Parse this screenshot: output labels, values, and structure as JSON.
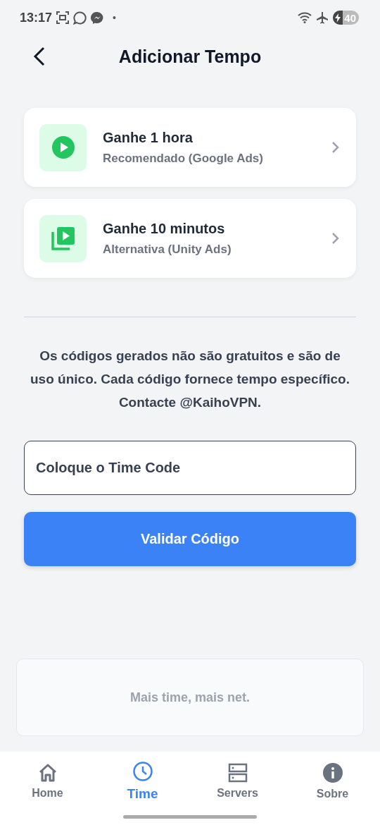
{
  "status_bar": {
    "time": "13:17",
    "dot": "•",
    "battery": "40"
  },
  "header": {
    "title": "Adicionar Tempo"
  },
  "options": [
    {
      "kind": "play",
      "title": "Ganhe 1 hora",
      "subtitle": "Recomendado (Google Ads)"
    },
    {
      "kind": "library",
      "title": "Ganhe 10 minutos",
      "subtitle": "Alternativa (Unity Ads)"
    }
  ],
  "notice": "Os códigos gerados não são gratuitos e são de uso único. Cada código fornece tempo específico. Contacte @KaihoVPN.",
  "code_field": {
    "placeholder": "Coloque o Time Code"
  },
  "validate_button": "Validar Código",
  "banner": "Mais time, mais net.",
  "nav": [
    {
      "kind": "home",
      "label": "Home",
      "selected": false
    },
    {
      "kind": "clock",
      "label": "Time",
      "selected": true
    },
    {
      "kind": "servers",
      "label": "Servers",
      "selected": false
    },
    {
      "kind": "info",
      "label": "Sobre",
      "selected": false
    }
  ]
}
